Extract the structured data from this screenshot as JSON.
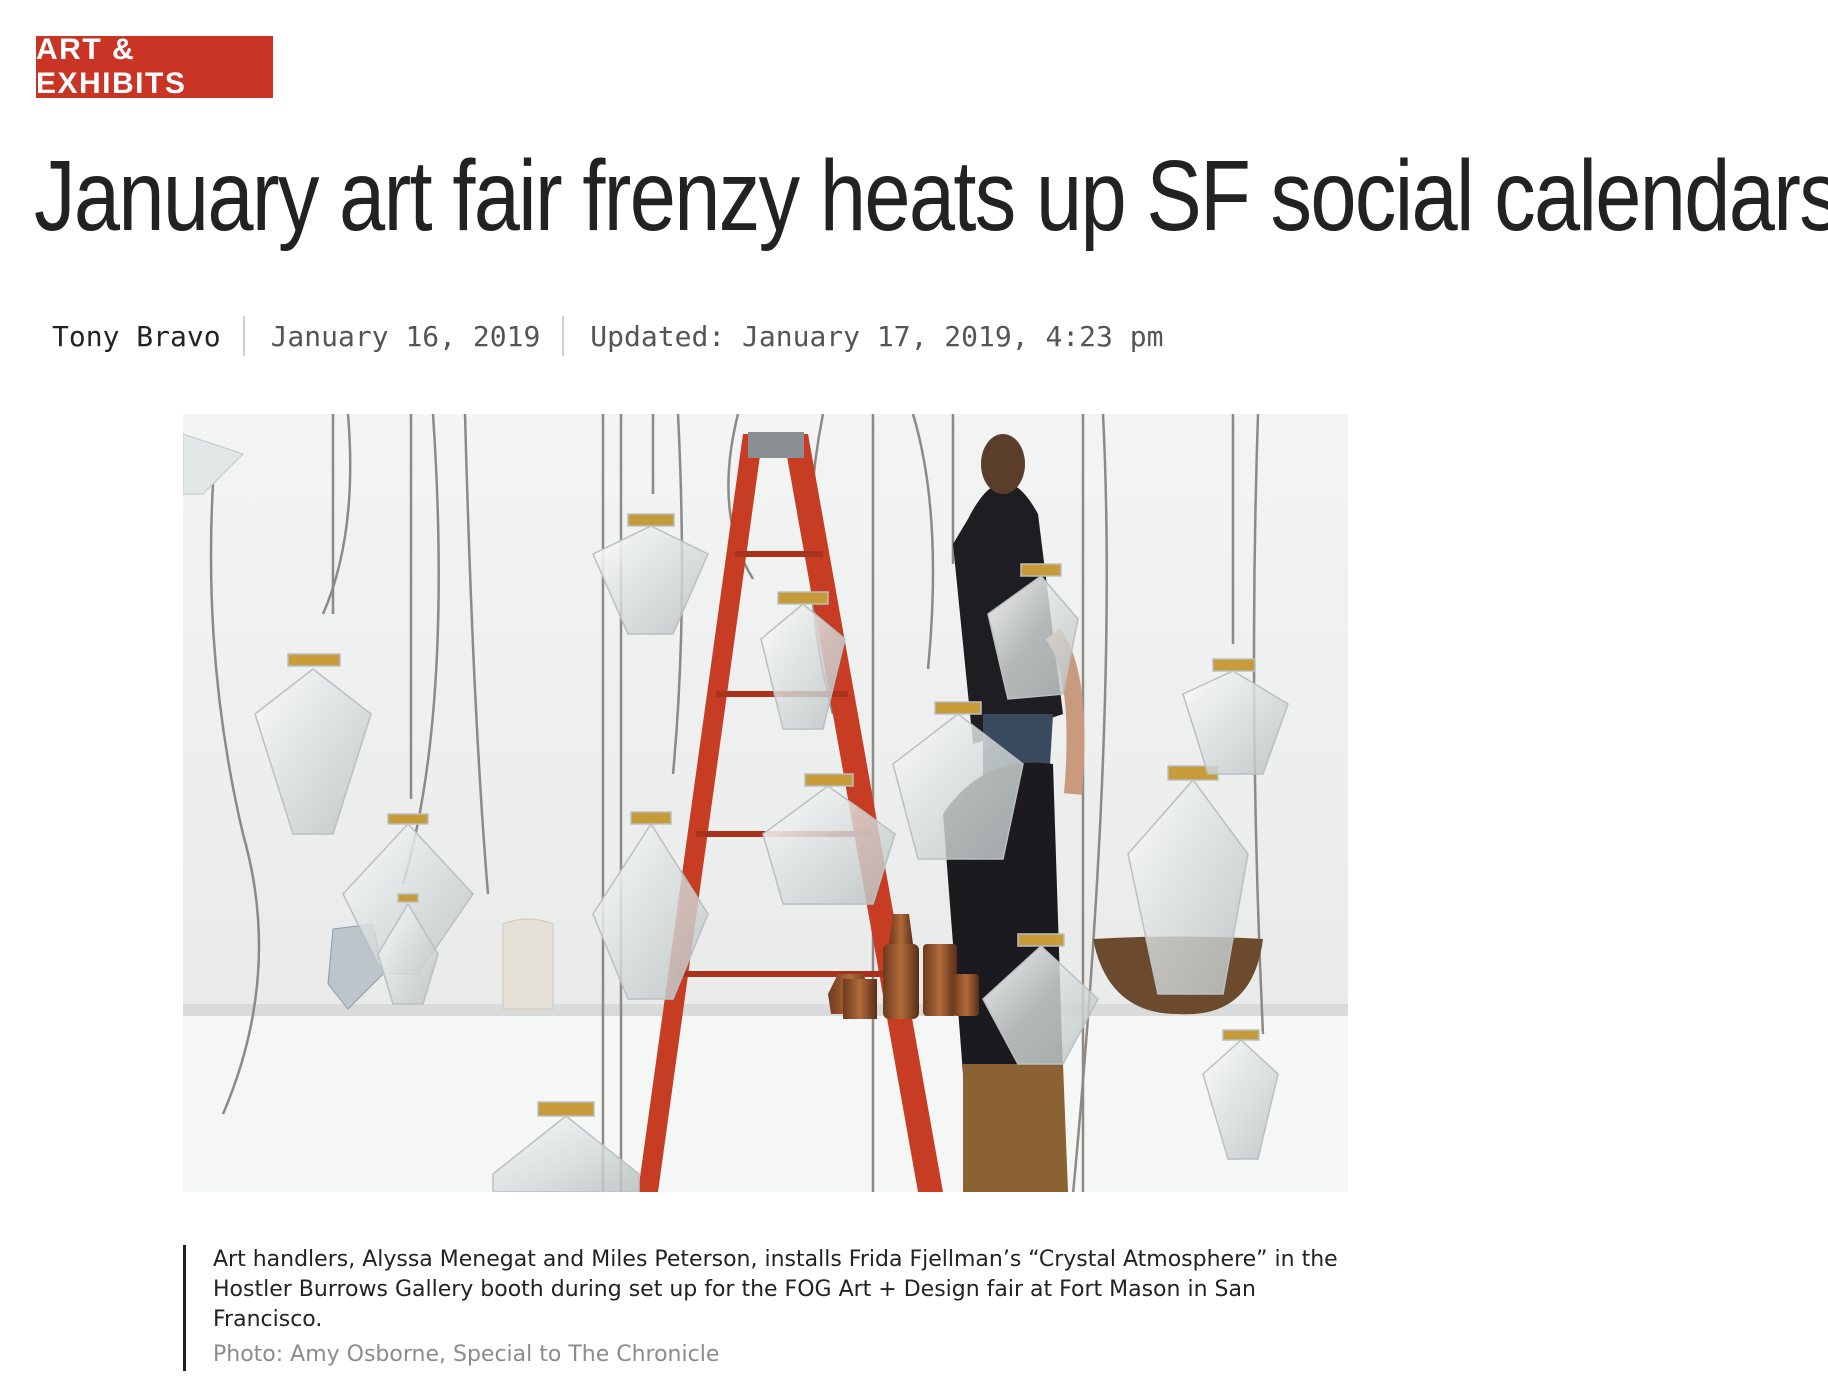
{
  "section": {
    "label": "ART & EXHIBITS"
  },
  "article": {
    "headline": "January art fair frenzy heats up SF social calendars",
    "byline": {
      "author": "Tony Bravo",
      "published": "January 16, 2019",
      "updated": "Updated: January 17, 2019, 4:23 pm"
    },
    "hero_image": {
      "alt": "Art handlers installing Crystal Atmosphere pendant glass lights"
    },
    "caption": {
      "text": "Art handlers, Alyssa Menegat and Miles Peterson, installs Frida Fjellman’s “Crystal Atmosphere” in the Hostler Burrows Gallery booth during set up for the FOG Art + Design fair at Fort Mason in San Francisco.",
      "credit": "Photo: Amy Osborne, Special to The Chronicle"
    }
  },
  "colors": {
    "accent": "#c93425",
    "text": "#222222",
    "muted": "#8c8c8c"
  }
}
